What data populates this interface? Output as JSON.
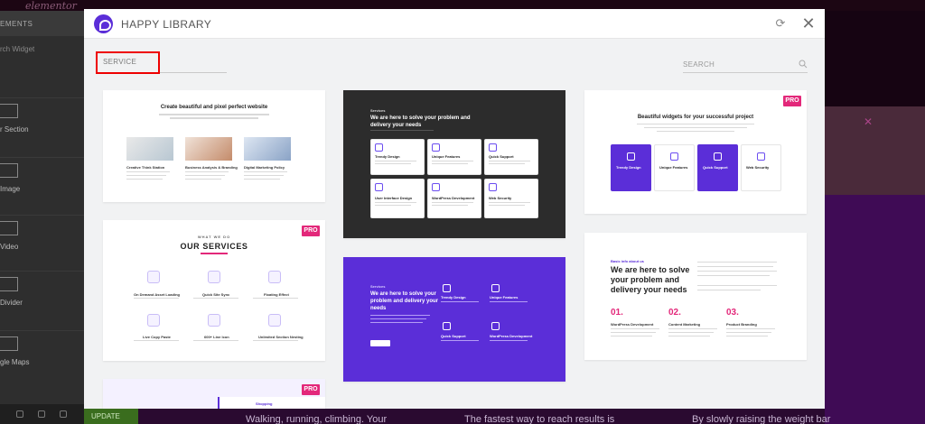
{
  "background": {
    "logo": "elementor",
    "panel_header": "EMENTS",
    "panel_search": "rch Widget",
    "panel_items": [
      "r Section",
      "Image",
      "Video",
      "Divider",
      "gle Maps"
    ],
    "update_label": "UPDATE",
    "bottom_texts": [
      "Walking, running, climbing. Your",
      "The fastest way to reach results is",
      "By slowly raising the weight bar"
    ]
  },
  "modal": {
    "title": "HAPPY LIBRARY",
    "filter_value": "SERVICE",
    "search_placeholder": "SEARCH",
    "icons": {
      "brand": "happy-addons-logo",
      "sync": "sync-icon",
      "close": "close-icon",
      "search": "search-icon"
    },
    "pro_badge": "PRO",
    "colors": {
      "accent": "#5b2ed8",
      "pro": "#e3287a",
      "filter_highlight": "#ee0000"
    }
  },
  "templates": [
    {
      "title": "Create beautiful and pixel perfect website",
      "items": [
        "Creative Think Station",
        "Business Analysis & Branding",
        "Digital Marketing Policy"
      ]
    },
    {
      "heading": "Services",
      "title_lines": [
        "We are here to solve your problem and",
        "delivery your needs"
      ],
      "tiles": [
        "Trendy Design",
        "Unique Features",
        "Quick Support",
        "User Interface Design",
        "WordPress Development",
        "Web Security"
      ]
    },
    {
      "title": "Beautiful widgets for your successful project",
      "tiles": [
        "Trendy Design",
        "Unique Features",
        "Quick Support",
        "Web Security"
      ]
    },
    {
      "eyebrow": "WHAT WE DO",
      "title": "OUR SERVICES",
      "items": [
        "On Demand Asset Loading",
        "Quick Site Sync",
        "Floating Effect",
        "Live Copy Paste",
        "600+ Line Icon",
        "Unlimited Section Nesting"
      ]
    },
    {
      "heading": "Services",
      "title_lines": [
        "We are here to solve your",
        "problem and delivery your",
        "needs"
      ],
      "tiles": [
        "Trendy Design",
        "Unique Features",
        "Quick Support",
        "WordPress Development"
      ]
    },
    {
      "eyebrow": "Basic info about us",
      "title_lines": [
        "We are here to solve",
        "your problem and",
        "delivery your needs"
      ],
      "numbers": [
        "01.",
        "02.",
        "03."
      ],
      "steps": [
        "WordPress Development",
        "Content Marketing",
        "Product Branding"
      ]
    },
    {
      "label": "Shopping"
    }
  ]
}
